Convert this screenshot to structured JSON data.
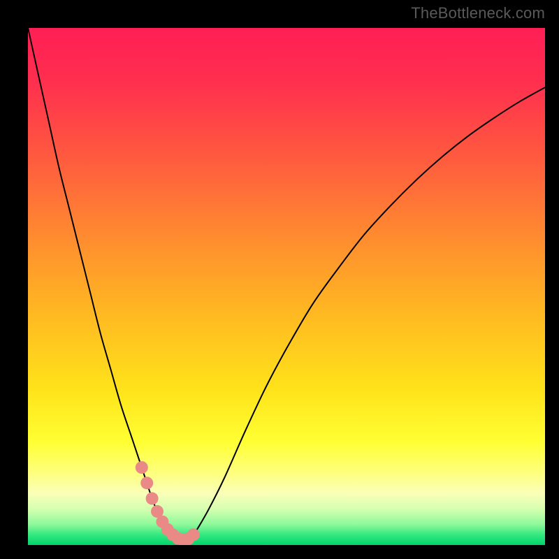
{
  "watermark": "TheBottleneck.com",
  "colors": {
    "frame": "#000000",
    "curve": "#000000",
    "dots": "#e98a87",
    "gradient_top": "#ff1f55",
    "gradient_bottom": "#00d46c"
  },
  "chart_data": {
    "type": "line",
    "title": "",
    "xlabel": "",
    "ylabel": "",
    "xlim": [
      0,
      100
    ],
    "ylim": [
      0,
      100
    ],
    "x": [
      0,
      2,
      4,
      6,
      8,
      10,
      12,
      14,
      16,
      18,
      20,
      22,
      23,
      24,
      25,
      26,
      27,
      28,
      29,
      30,
      31,
      32,
      33,
      35,
      38,
      42,
      46,
      50,
      55,
      60,
      65,
      70,
      75,
      80,
      85,
      90,
      95,
      100
    ],
    "values": [
      100,
      91,
      82,
      73,
      65,
      57,
      49,
      41,
      34,
      27,
      21,
      15,
      12,
      9,
      6.5,
      4.5,
      3,
      2,
      1.3,
      1,
      1.2,
      2,
      3.5,
      7,
      13,
      22,
      30.5,
      38,
      46.5,
      53.5,
      60,
      65.5,
      70.5,
      75,
      79,
      82.5,
      85.7,
      88.5
    ],
    "markers_x": [
      22,
      23,
      24,
      25,
      26,
      27,
      28,
      29,
      30,
      31,
      32
    ],
    "markers_y": [
      15,
      12,
      9,
      6.5,
      4.5,
      3,
      2,
      1.3,
      1,
      1.2,
      2
    ]
  }
}
